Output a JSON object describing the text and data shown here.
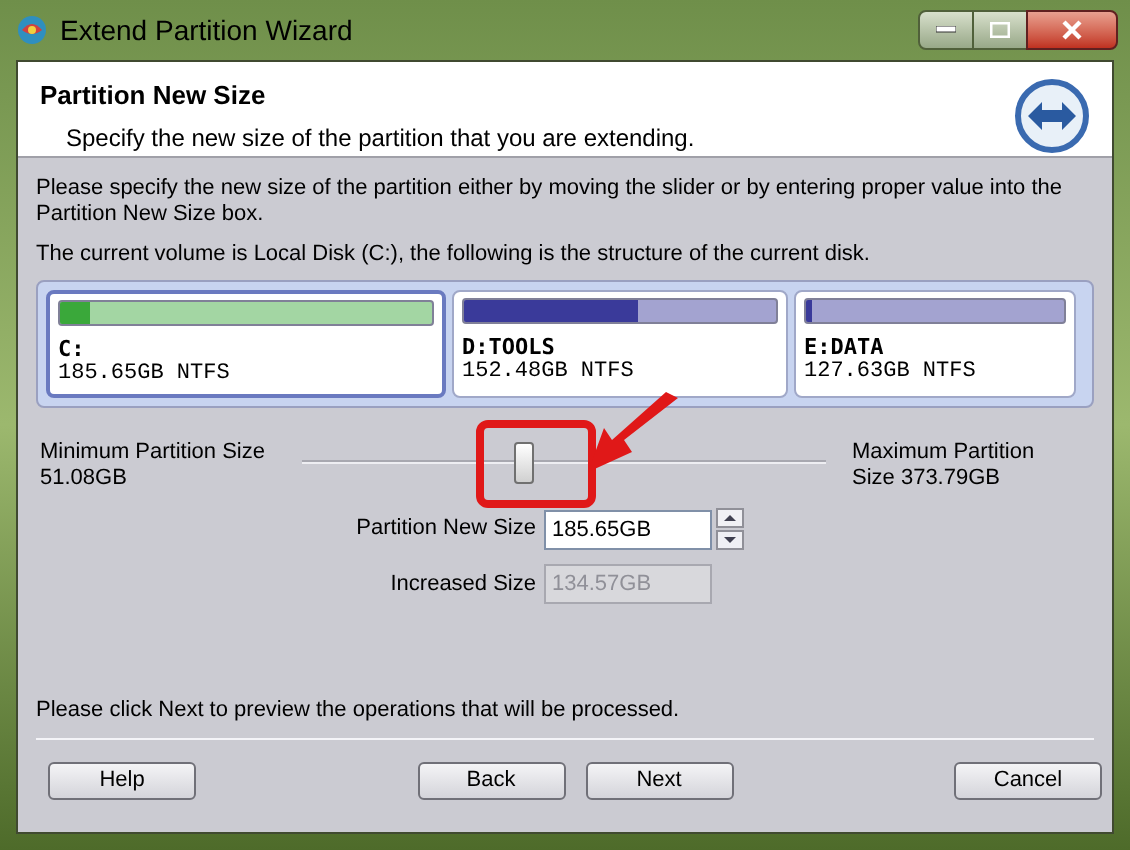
{
  "window": {
    "title": "Extend Partition Wizard"
  },
  "header": {
    "title": "Partition New Size",
    "subtitle": "Specify the new size of the partition that you are extending."
  },
  "instructions": [
    "Please specify the new size of the partition either by moving the slider or by entering proper value into the Partition New Size box.",
    "The current volume is Local Disk (C:), the following is the structure of the current disk."
  ],
  "partitions": [
    {
      "name": "C:",
      "info": "185.65GB NTFS",
      "level": 0.08,
      "color": "#3aa83a",
      "selected": true
    },
    {
      "name": "D:TOOLS",
      "info": "152.48GB NTFS",
      "level": 0.56,
      "color": "#3a3a9a",
      "selected": false
    },
    {
      "name": "E:DATA",
      "info": "127.63GB NTFS",
      "level": 0.02,
      "color": "#3a3a9a",
      "selected": false
    }
  ],
  "slider": {
    "min_label": "Minimum Partition Size",
    "min_value": "51.08GB",
    "max_label": "Maximum Partition",
    "max_value": "Size 373.79GB",
    "level": 0.42
  },
  "fields": [
    {
      "label": "Partition New Size",
      "value": "185.65GB",
      "disabled": false,
      "spinner": true
    },
    {
      "label": "Increased Size",
      "value": "134.57GB",
      "disabled": true,
      "spinner": false
    }
  ],
  "footer_note": "Please click Next to preview the operations that will be processed.",
  "buttons": [
    {
      "label": "Help"
    },
    {
      "label": "Back"
    },
    {
      "label": "Next"
    },
    {
      "label": "Cancel"
    }
  ]
}
